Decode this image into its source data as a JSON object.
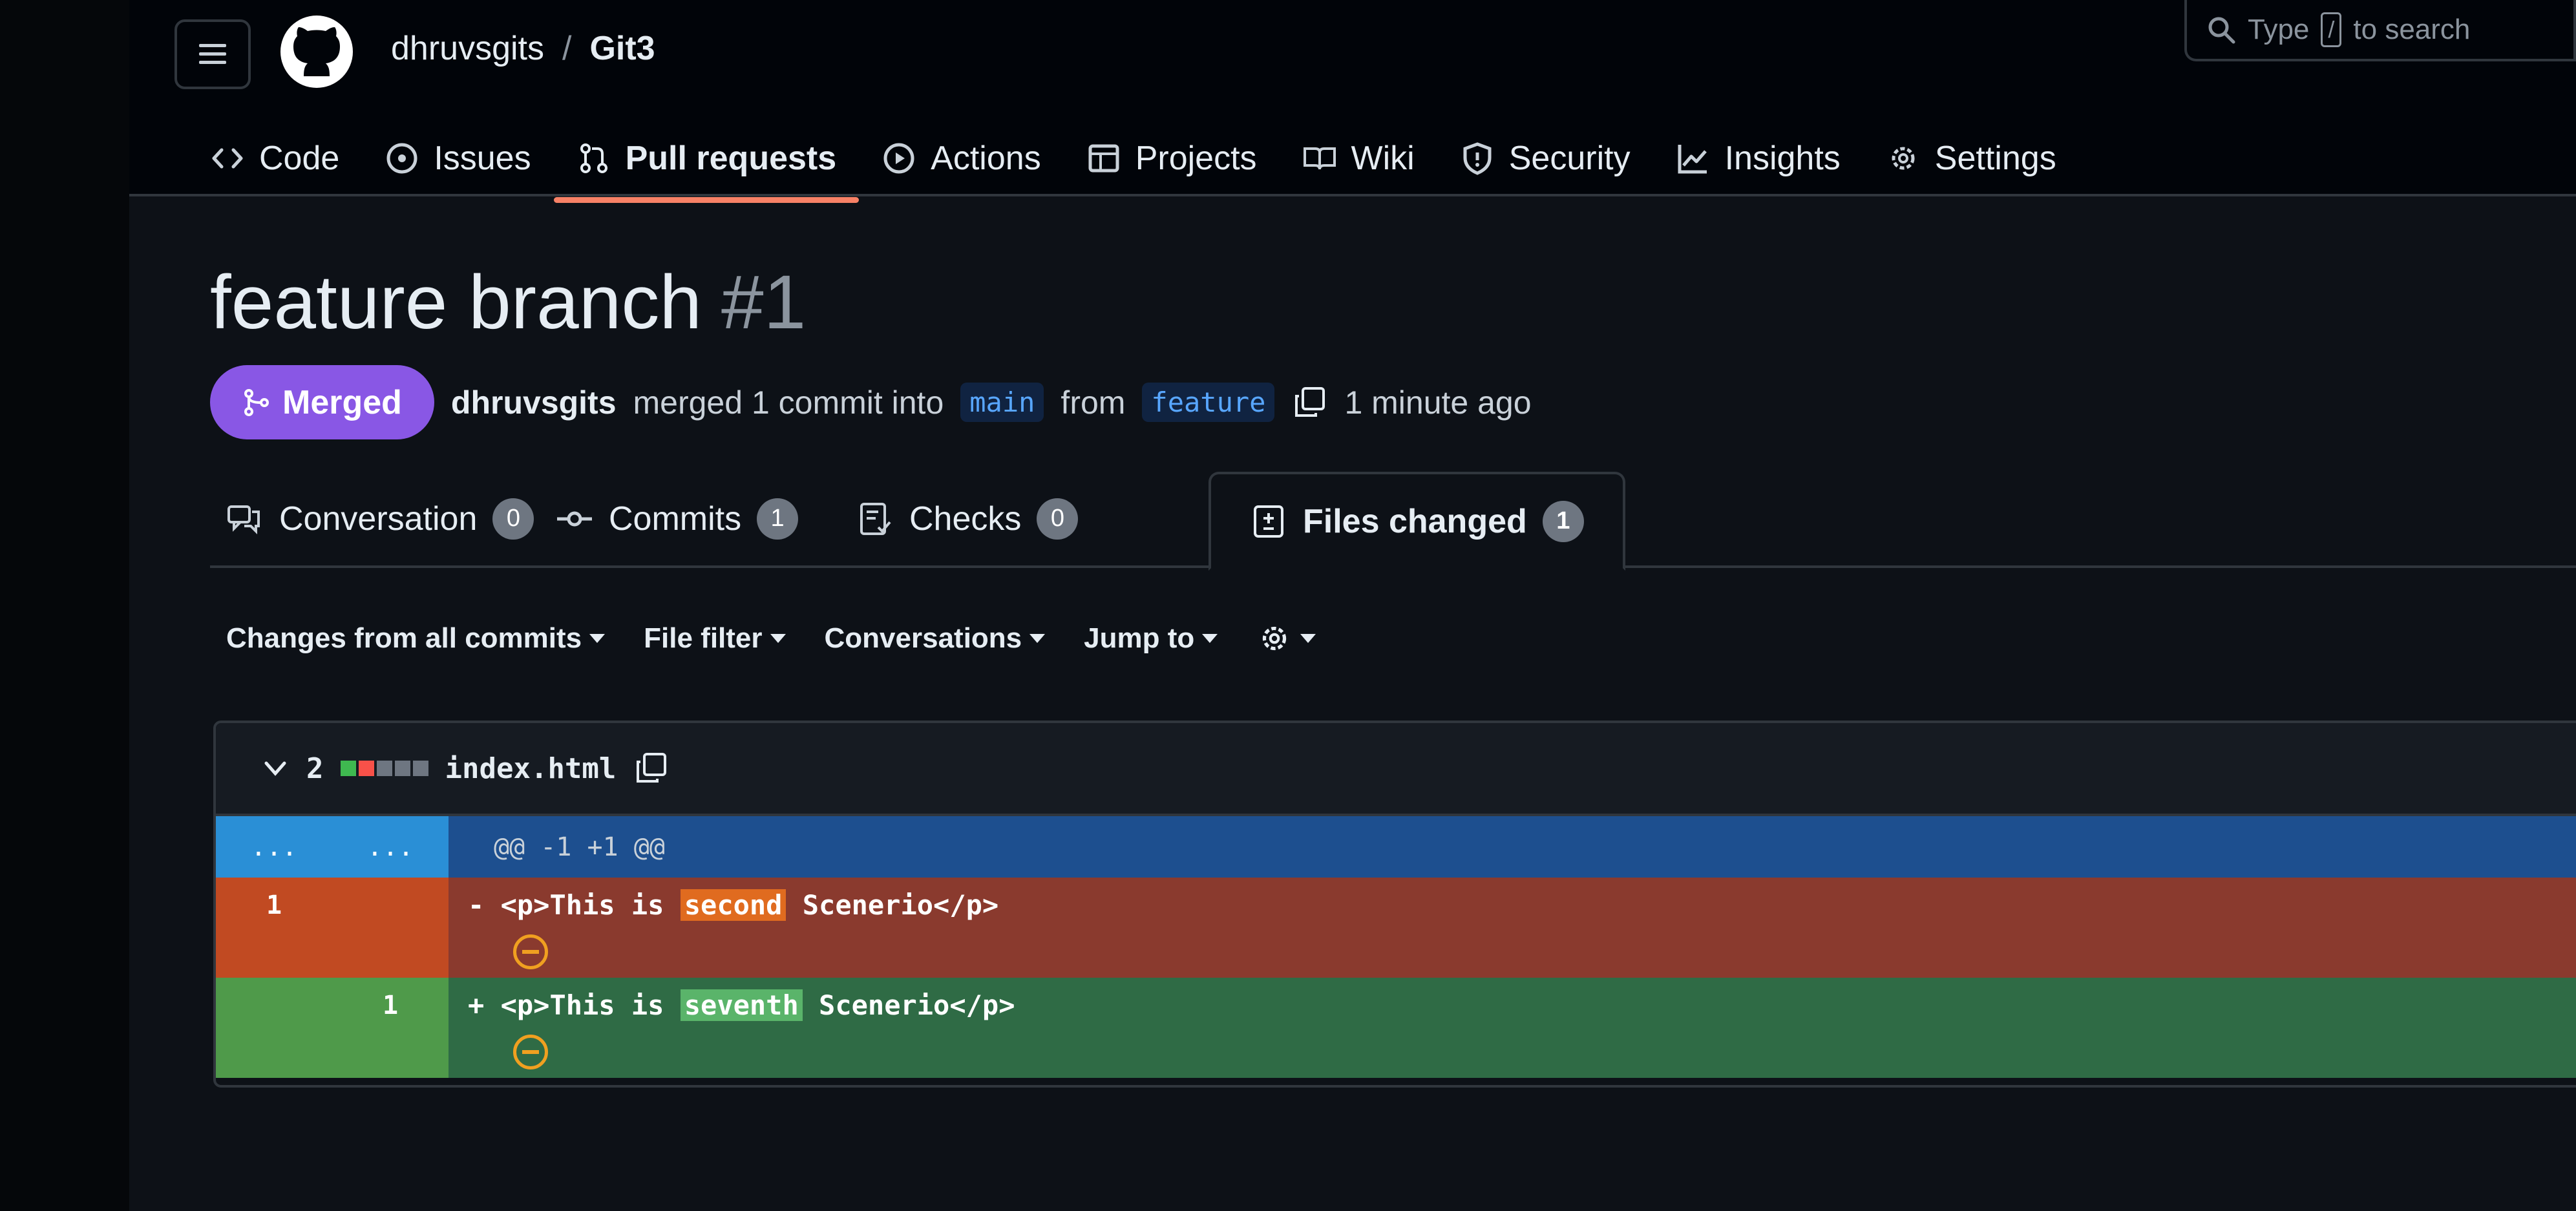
{
  "header": {
    "owner": "dhruvsgits",
    "separator": "/",
    "repo": "Git3",
    "search": {
      "prefix": "Type",
      "key": "/",
      "suffix": "to search"
    }
  },
  "nav": {
    "items": [
      {
        "label": "Code",
        "icon": "code-icon"
      },
      {
        "label": "Issues",
        "icon": "issue-icon"
      },
      {
        "label": "Pull requests",
        "icon": "pull-request-icon",
        "active": true
      },
      {
        "label": "Actions",
        "icon": "play-icon"
      },
      {
        "label": "Projects",
        "icon": "table-icon"
      },
      {
        "label": "Wiki",
        "icon": "book-icon"
      },
      {
        "label": "Security",
        "icon": "shield-icon"
      },
      {
        "label": "Insights",
        "icon": "graph-icon"
      },
      {
        "label": "Settings",
        "icon": "gear-icon"
      }
    ]
  },
  "pr": {
    "title": "feature branch",
    "number": "#1",
    "state": "Merged",
    "author": "dhruvsgits",
    "action_text": "merged 1 commit into",
    "base": "main",
    "from_text": "from",
    "head": "feature",
    "time": "1 minute ago"
  },
  "tabs": [
    {
      "label": "Conversation",
      "count": "0"
    },
    {
      "label": "Commits",
      "count": "1"
    },
    {
      "label": "Checks",
      "count": "0"
    },
    {
      "label": "Files changed",
      "count": "1",
      "selected": true
    }
  ],
  "toolbar": {
    "changes": "Changes from all commits",
    "file_filter": "File filter",
    "conversations": "Conversations",
    "jump_to": "Jump to"
  },
  "diff": {
    "changes_count": "2",
    "filename": "index.html",
    "hunk_left": "...",
    "hunk_right": "...",
    "hunk_header": "@@ -1 +1 @@",
    "deleted": {
      "line": "1",
      "sign": "-",
      "before": "<p>This is ",
      "highlight": "second",
      "after": " Scenerio</p>"
    },
    "added": {
      "line": "1",
      "sign": "+",
      "before": "<p>This is ",
      "highlight": "seventh",
      "after": " Scenerio</p>"
    },
    "colors": {
      "deleted_bg": "#8a3a2e",
      "added_bg": "#2f6b45",
      "hunk_bg": "#1d4f8f",
      "merged": "#8957e5"
    }
  }
}
